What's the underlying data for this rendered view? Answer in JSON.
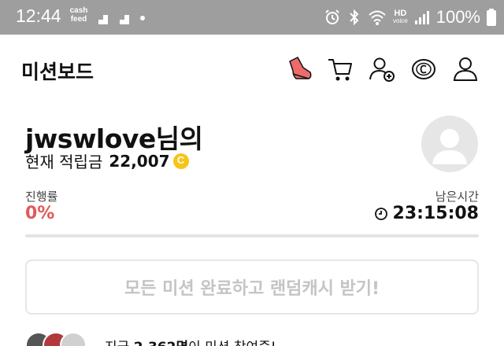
{
  "status_bar": {
    "time": "12:44",
    "cash_app_line1": "cash",
    "cash_app_line2": "feed",
    "hd_label": "HD",
    "voice_label": "voice",
    "battery_text": "100%",
    "icons": [
      "alarm-icon",
      "bluetooth-icon",
      "wifi-icon",
      "signal-icon",
      "battery-icon"
    ]
  },
  "header": {
    "title": "미션보드",
    "icons": [
      "mission-shoe-icon",
      "cart-icon",
      "add-friend-icon",
      "cash-coin-icon",
      "profile-icon"
    ]
  },
  "profile": {
    "username": "jwswlove님의",
    "points_label": "현재 적립금",
    "points_value": "22,007",
    "coin_color": "#f5c518"
  },
  "stats": {
    "progress_label": "진행률",
    "progress_value": "0%",
    "progress_fraction": 0,
    "remaining_label": "남은시간",
    "remaining_value": "23:15:08",
    "accent_color": "#e05a5a"
  },
  "cta": {
    "label": "모든 미션 완료하고 랜덤캐시 받기!"
  },
  "participants": {
    "prefix": "지금 ",
    "count": "2,362명",
    "suffix": "이 미션 참여중!"
  }
}
